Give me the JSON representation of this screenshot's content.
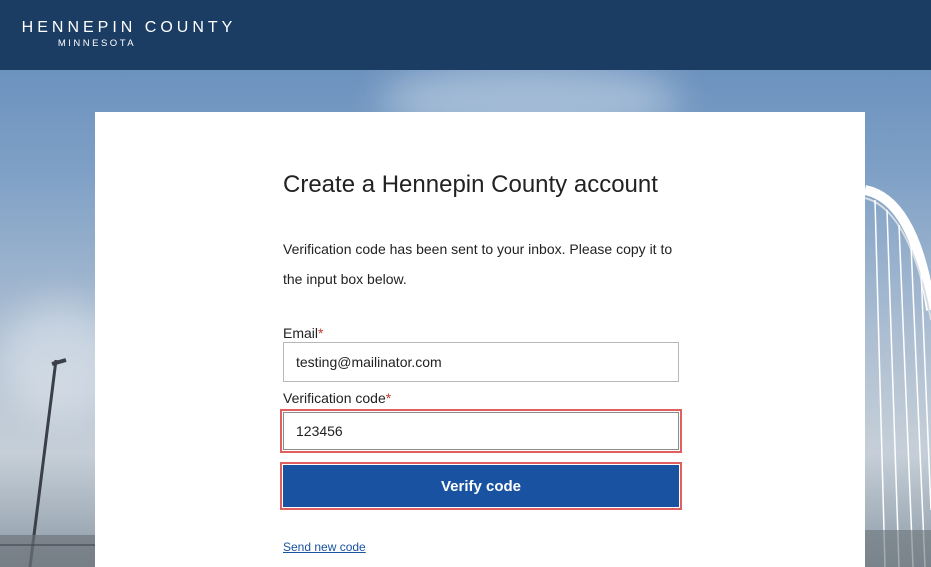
{
  "header": {
    "brand_main": "HENNEPIN COUNTY",
    "brand_sub": "MINNESOTA"
  },
  "form": {
    "title": "Create a Hennepin County account",
    "description": "Verification code has been sent to your inbox. Please copy it to the input box below.",
    "email_label": "Email",
    "email_value": "testing@mailinator.com",
    "code_label": "Verification code",
    "code_value": "123456",
    "required_marker": "*",
    "verify_button": "Verify code",
    "send_new_link": "Send new code"
  },
  "colors": {
    "header_bg": "#1c3d63",
    "button_bg": "#1852a0",
    "highlight": "#e06060",
    "required": "#c0392b"
  }
}
